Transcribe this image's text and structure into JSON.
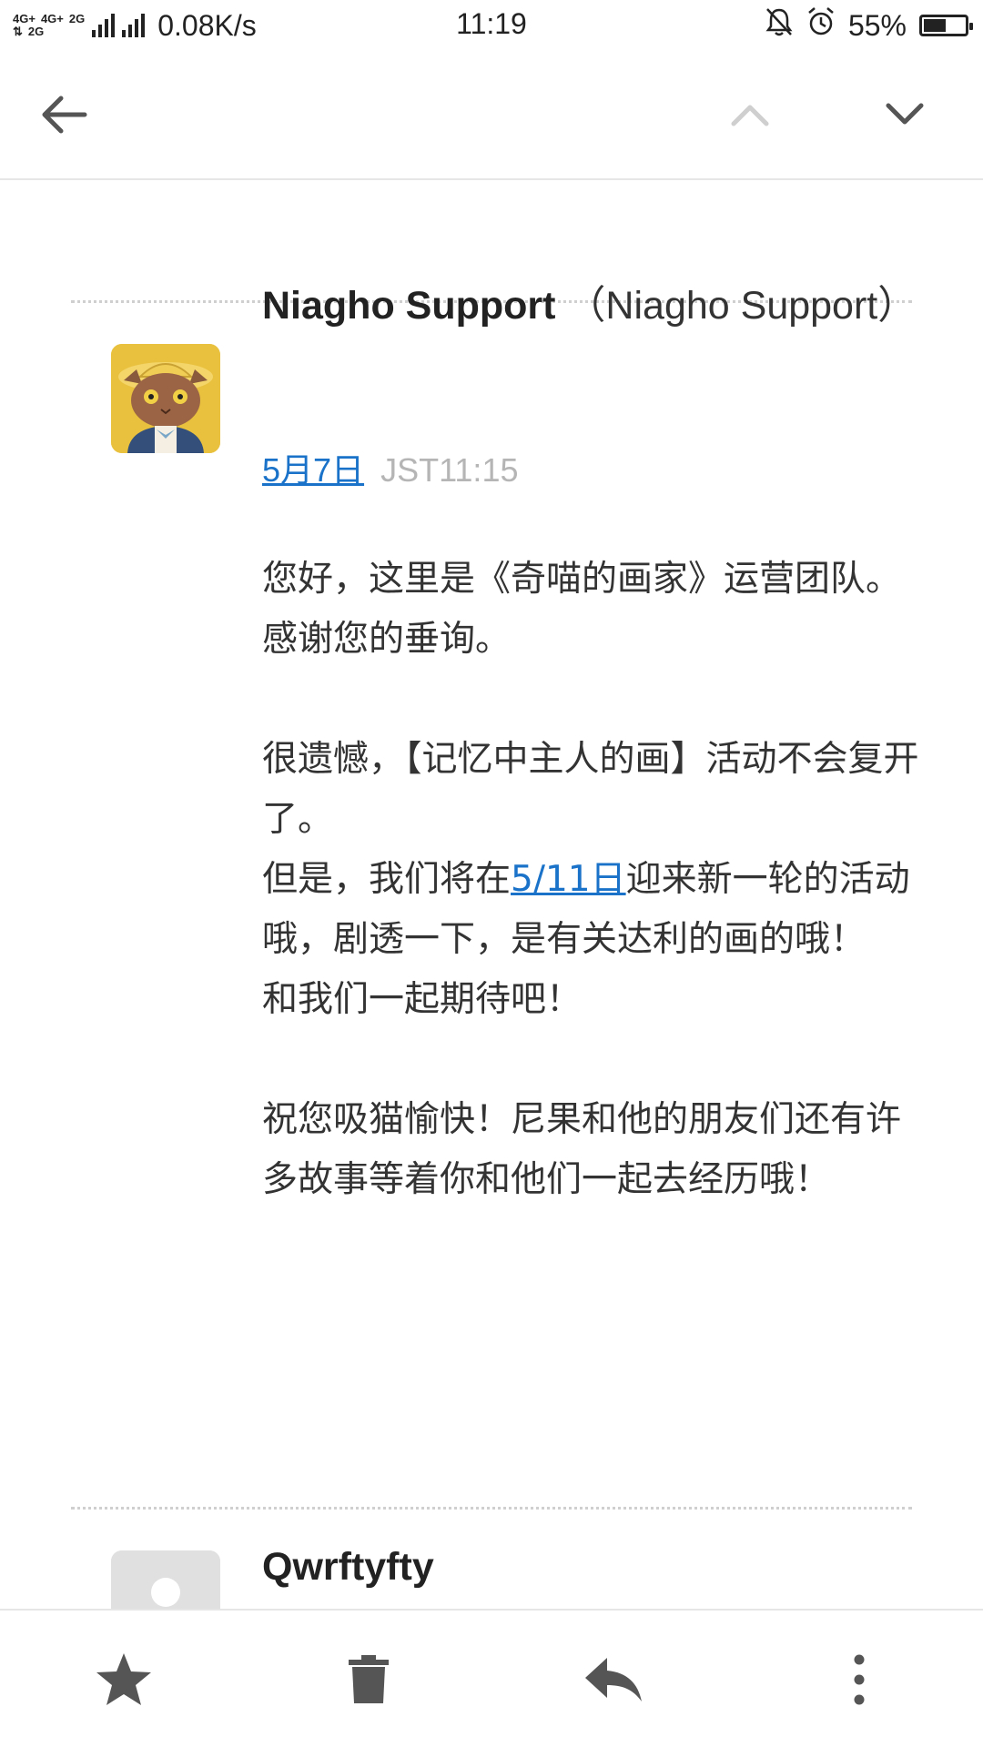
{
  "status_bar": {
    "net_tags_top": [
      "4G+",
      "4G+",
      "2G"
    ],
    "net_tags_bottom": [
      "⇅",
      "2G"
    ],
    "speed": "0.08K/s",
    "time": "11:19",
    "battery": "55%",
    "battery_level": 0.55,
    "icons": [
      "bell-off-icon",
      "alarm-icon",
      "battery-icon"
    ]
  },
  "app_bar": {
    "icons": [
      "back-arrow-icon",
      "chevron-up-icon",
      "chevron-down-icon"
    ]
  },
  "message": {
    "sender_name": "Niagho Support",
    "sender_addr": "（Niagho Support）",
    "date": "5月7日",
    "time": "JST11:15",
    "body": {
      "p1": "您好，这里是《奇喵的画家》运营团队。",
      "p2": "感谢您的垂询。",
      "p3": "很遗憾，【记忆中主人的画】活动不会复开了。",
      "p4_pre": "但是，我们将在",
      "p4_link": "5/11日",
      "p4_post": "迎来新一轮的活动哦，剧透一下，是有关达利的画的哦！",
      "p5": "和我们一起期待吧！",
      "p6": "祝您吸猫愉快！尼果和他的朋友们还有许多故事等着你和他们一起去经历哦！"
    }
  },
  "next_message": {
    "sender_name": "Qwrftyfty"
  },
  "toolbar": {
    "icons": [
      "star-icon",
      "trash-icon",
      "reply-icon",
      "more-vert-icon"
    ]
  },
  "colors": {
    "link": "#1a73c9",
    "muted": "#b5b5b5",
    "avatar_bg": "#e9c13e"
  }
}
